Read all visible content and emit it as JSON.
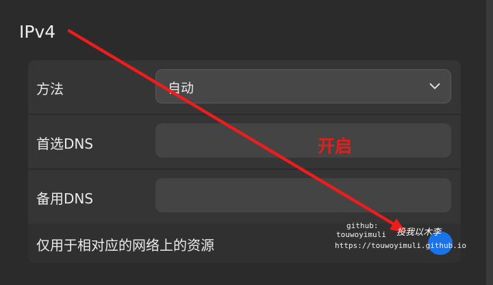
{
  "section": {
    "title": "IPv4"
  },
  "rows": {
    "method": {
      "label": "方法",
      "value": "自动"
    },
    "preferred_dns": {
      "label": "首选DNS",
      "value": ""
    },
    "alternate_dns": {
      "label": "备用DNS",
      "value": ""
    },
    "local_only": {
      "label": "仅用于相对应的网络上的资源",
      "toggle_on": true
    }
  },
  "annotation": {
    "text": "开启"
  },
  "watermark": {
    "line1": "github:",
    "line2": "touwoyimuli",
    "signature": "投我以木李",
    "line3": "https://touwoyimuli.github.io"
  },
  "colors": {
    "toggle_active": "#1a73e8",
    "annotation": "#e0201c"
  }
}
